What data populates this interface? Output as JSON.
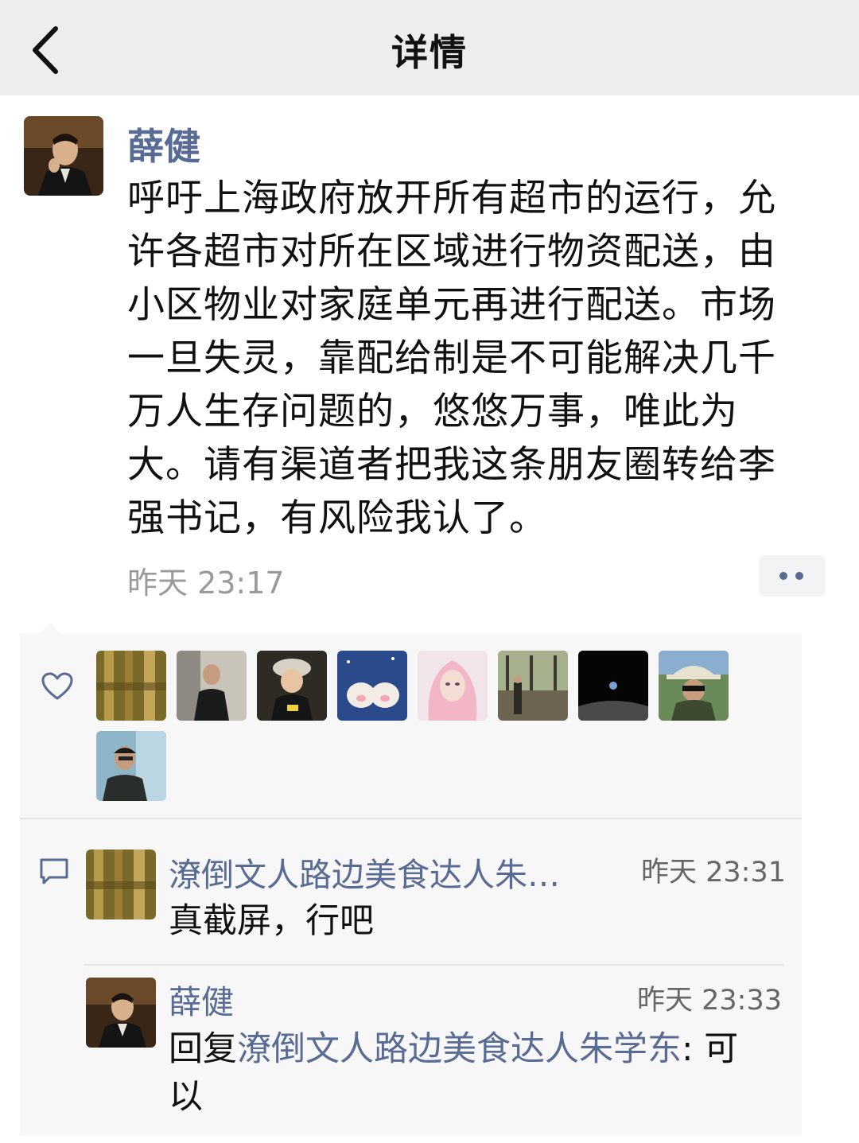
{
  "header": {
    "title": "详情",
    "back_icon": "chevron-left-icon"
  },
  "post": {
    "author": "薛健",
    "lines": [
      "呼吁上海政府放开所有超市的运行，允",
      "许各超市对所在区域进行物资配送，由",
      "小区物业对家庭单元再进行配送。市场",
      "一旦失灵，靠配给制是不可能解决几千",
      "万人生存问题的，悠悠万事，唯此为",
      "大。请有渠道者把我这条朋友圈转给李",
      "强书记，有风险我认了。"
    ],
    "time": "昨天 23:17",
    "more_icon": "more-dots-icon"
  },
  "likes": {
    "icon": "heart-icon",
    "count": 9
  },
  "comments": [
    {
      "author": "潦倒文人路边美食达人朱…",
      "time": "昨天 23:31",
      "text": "真截屏，行吧"
    },
    {
      "author": "薛健",
      "time": "昨天 23:33",
      "reply_prefix": "回复",
      "reply_to": "潦倒文人路边美食达人朱学东",
      "reply_line1_rest": ": 可",
      "reply_line2": "以"
    }
  ],
  "colors": {
    "nav_bg": "#ededed",
    "link": "#586b95",
    "panel_bg": "#f7f7f7",
    "time": "#9a9a9a"
  }
}
